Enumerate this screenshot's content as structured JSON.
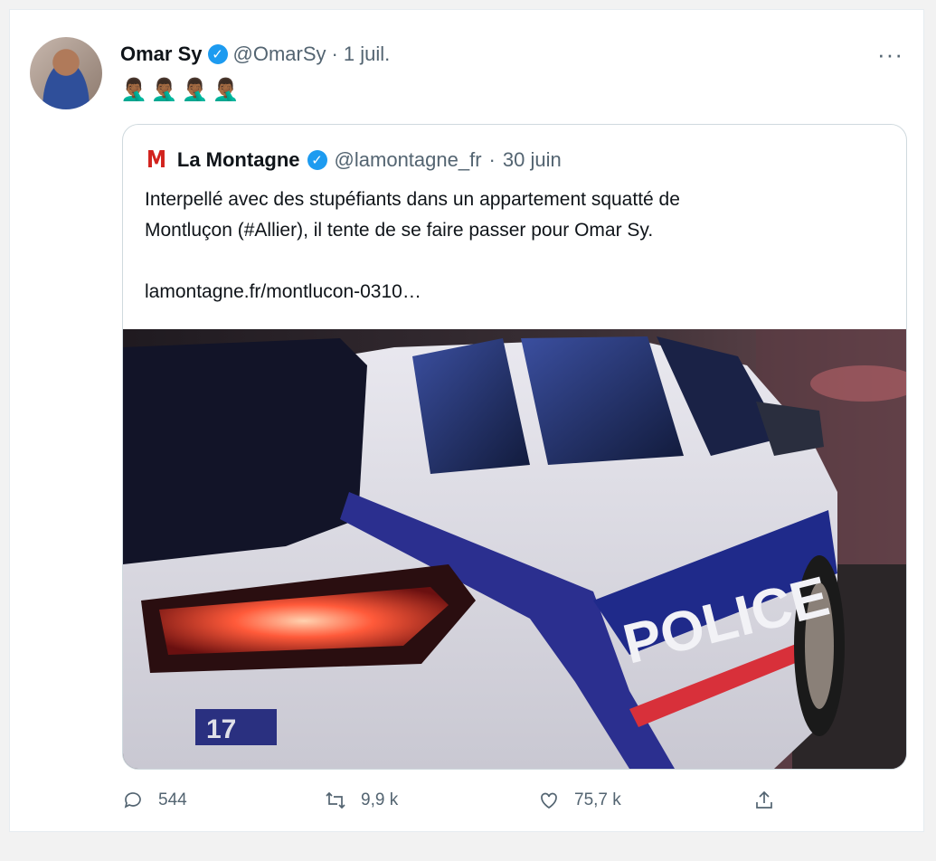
{
  "tweet": {
    "author_name": "Omar Sy",
    "handle": "@OmarSy",
    "separator": "·",
    "date": "1 juil.",
    "more_label": "···",
    "emoji_text": "🤦🏾‍♂️🤦🏾‍♂️🤦🏾‍♂️🤦🏾‍♂️",
    "verified_icon": "check-badge-icon",
    "verified_color": "#1d9bf0"
  },
  "quoted": {
    "logo_text": "M",
    "logo_color": "#d2231e",
    "author_name": "La Montagne",
    "handle": "@lamontagne_fr",
    "separator": "·",
    "date": "30 juin",
    "text_line1": "Interpellé avec des stupéfiants dans un appartement squatté de",
    "text_line2": "Montluçon (#Allier), il tente de se faire passer pour Omar Sy.",
    "link": "lamontagne.fr/montlucon-0310…",
    "image_text": "POLICE",
    "plate_text": "17"
  },
  "actions": {
    "reply_count": "544",
    "retweet_count": "9,9 k",
    "like_count": "75,7 k",
    "icons": [
      "reply-icon",
      "retweet-icon",
      "like-icon",
      "share-icon"
    ]
  }
}
